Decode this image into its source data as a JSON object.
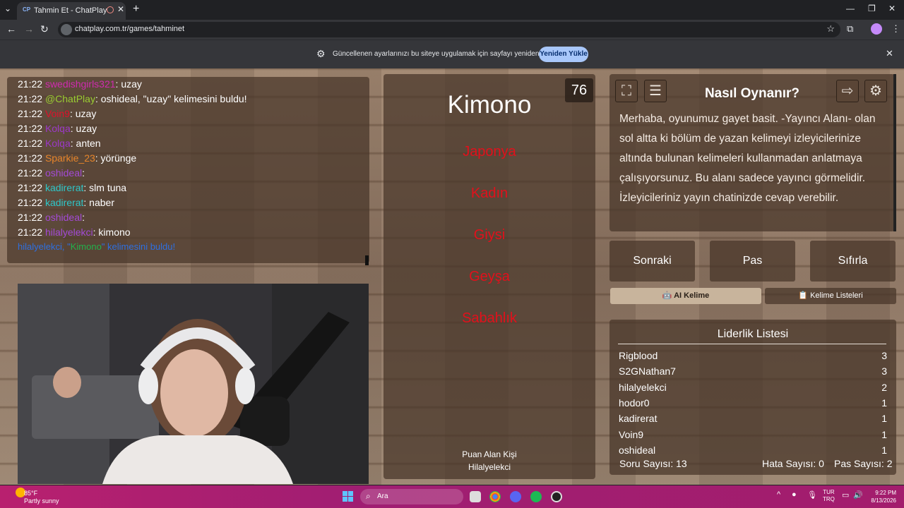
{
  "browser": {
    "tab_title": "Tahmin Et - ChatPlay",
    "tab_favicon": "CP",
    "url": "chatplay.com.tr/games/tahminet",
    "infobar_message": "Güncellenen ayarlarınızı bu siteye uygulamak için sayfayı yeniden yükleyin",
    "reload_button": "Yeniden Yükle"
  },
  "chat": {
    "lines": [
      {
        "time": "21:22",
        "user": "swedishgirls321",
        "color": "#d02bb0",
        "msg": ": uzay"
      },
      {
        "time": "21:22",
        "user": "@ChatPlay",
        "color": "#9acd32",
        "msg": ": oshideal, \"uzay\" kelimesini buldu!"
      },
      {
        "time": "21:22",
        "user": "Voin9",
        "color": "#e0102b",
        "msg": ": uzay"
      },
      {
        "time": "21:22",
        "user": "Kolqa",
        "color": "#9b38c8",
        "msg": ": uzay"
      },
      {
        "time": "21:22",
        "user": "Kolqa",
        "color": "#9b38c8",
        "msg": ": anten"
      },
      {
        "time": "21:22",
        "user": "Sparkie_23",
        "color": "#e6842a",
        "msg": ": yörünge"
      },
      {
        "time": "21:22",
        "user": "oshideal",
        "color": "#a34ad6",
        "msg": ":"
      },
      {
        "time": "21:22",
        "user": "kadirerat",
        "color": "#2ec7c9",
        "msg": ": slm tuna"
      },
      {
        "time": "21:22",
        "user": "kadirerat",
        "color": "#2ec7c9",
        "msg": ": naber"
      },
      {
        "time": "21:22",
        "user": "oshideal",
        "color": "#a34ad6",
        "msg": ":"
      },
      {
        "time": "21:22",
        "user": "hilalyelekci",
        "color": "#a34ad6",
        "msg": ": kimono"
      }
    ],
    "found": {
      "user": "hilalyelekci",
      "sep": ", \"",
      "word": "Kimono",
      "end": "\" kelimesini buldu!"
    }
  },
  "game": {
    "timer": "76",
    "word": "Kimono",
    "forbidden": [
      "Japonya",
      "Kadın",
      "Giysi",
      "Geyşa",
      "Sabahlık"
    ],
    "scorer_label": "Puan Alan Kişi",
    "scorer_name": "Hilalyelekci"
  },
  "howto": {
    "title": "Nasıl Oynanır?",
    "text": "Merhaba, oyunumuz gayet basit. -Yayıncı Alanı- olan sol altta ki bölüm de yazan kelimeyi izleyicilerinize altında bulunan kelimeleri kullanmadan anlatmaya çalışıyorsunuz. Bu alanı sadece yayıncı görmelidir. İzleyicileriniz yayın chatinizde cevap verebilir."
  },
  "controls": {
    "next": "Sonraki",
    "pass": "Pas",
    "reset": "Sıfırla",
    "ai_word": "AI Kelime",
    "word_lists": "Kelime Listeleri"
  },
  "leaderboard": {
    "title": "Liderlik Listesi",
    "rows": [
      {
        "name": "Rigblood",
        "score": "3"
      },
      {
        "name": "S2GNathan7",
        "score": "3"
      },
      {
        "name": "hilalyelekci",
        "score": "2"
      },
      {
        "name": "hodor0",
        "score": "1"
      },
      {
        "name": "kadirerat",
        "score": "1"
      },
      {
        "name": "Voin9",
        "score": "1"
      },
      {
        "name": "oshideal",
        "score": "1"
      }
    ],
    "questions": "Soru Sayısı: 13",
    "errors": "Hata Sayısı: 0",
    "passes": "Pas Sayısı: 2"
  },
  "taskbar": {
    "temp": "85°F",
    "weather": "Partly sunny",
    "search_placeholder": "Ara",
    "lang_top": "TUR",
    "lang_bottom": "TRQ",
    "time": "9:22 PM",
    "date": "8/13/2026"
  }
}
